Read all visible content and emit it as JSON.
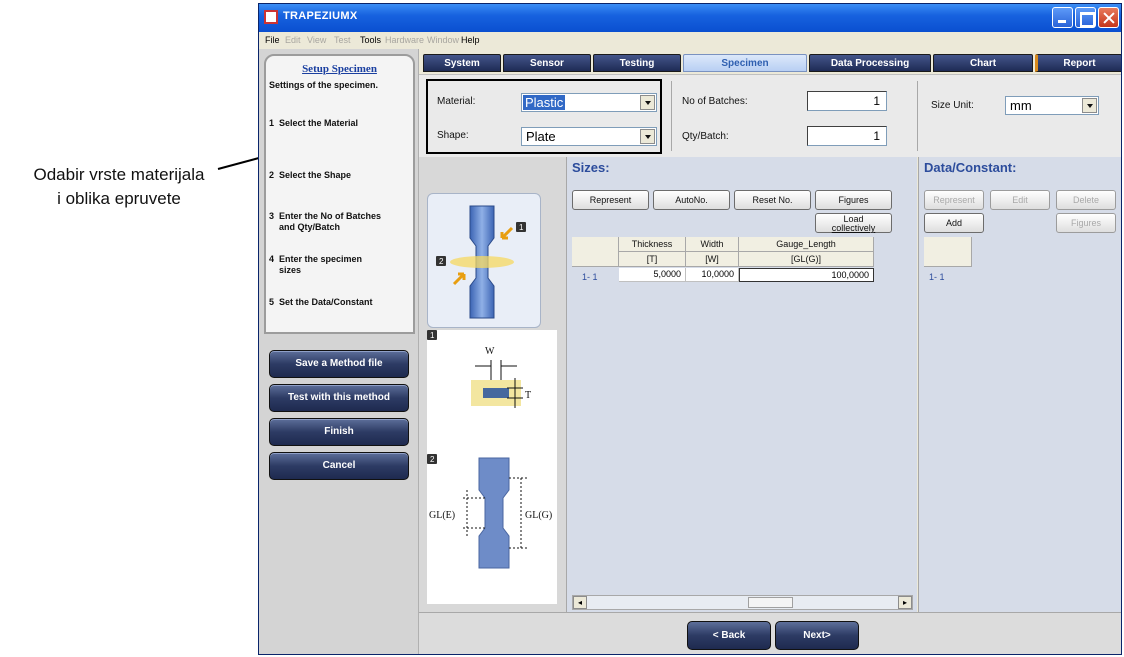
{
  "callout": {
    "line1": "Odabir vrste materijala",
    "line2": "i oblika epruvete"
  },
  "window": {
    "title": "TRAPEZIUMX"
  },
  "menu": {
    "file": "File",
    "edit": "Edit",
    "view": "View",
    "test": "Test",
    "tools": "Tools",
    "hardware": "Hardware",
    "window": "Window",
    "help": "Help"
  },
  "wizard": {
    "title": "Setup Specimen",
    "subtitle": "Settings of the specimen.",
    "steps": [
      {
        "num": "1",
        "text": "Select the Material"
      },
      {
        "num": "2",
        "text": "Select the Shape"
      },
      {
        "num": "3",
        "text": "Enter the No of Batches",
        "text2": "and Qty/Batch"
      },
      {
        "num": "4",
        "text": "Enter the specimen",
        "text2": "sizes"
      },
      {
        "num": "5",
        "text": "Set the Data/Constant"
      }
    ],
    "actions": [
      "Save a Method file",
      "Test with this method",
      "Finish",
      "Cancel"
    ]
  },
  "tabs": [
    "System",
    "Sensor",
    "Testing",
    "Specimen",
    "Data Processing",
    "Chart",
    "Report"
  ],
  "active_tab": "Specimen",
  "settings": {
    "material_label": "Material:",
    "material_value": "Plastic",
    "shape_label": "Shape:",
    "shape_value": "Plate",
    "batches_label": "No of Batches:",
    "batches_value": "1",
    "qty_label": "Qty/Batch:",
    "qty_value": "1",
    "size_unit_label": "Size Unit:",
    "size_unit_value": "mm"
  },
  "diagram": {
    "badge1": "1",
    "badge2": "2",
    "w_label": "W",
    "t_label": "T",
    "gle_label": "GL(E)",
    "glg_label": "GL(G)"
  },
  "sizes": {
    "title": "Sizes:",
    "buttons": {
      "represent": "Represent",
      "autono": "AutoNo.",
      "resetno": "Reset No.",
      "figures": "Figures",
      "load1": "Load",
      "load2": "collectively"
    },
    "columns": [
      {
        "name": "Thickness",
        "unit": "[T]"
      },
      {
        "name": "Width",
        "unit": "[W]"
      },
      {
        "name": "Gauge_Length",
        "unit": "[GL(G)]"
      }
    ],
    "rows": [
      {
        "label": "1- 1",
        "values": [
          "5,0000",
          "10,0000",
          "100,0000"
        ]
      }
    ]
  },
  "data_constant": {
    "title": "Data/Constant:",
    "buttons": {
      "represent": "Represent",
      "edit": "Edit",
      "delete": "Delete",
      "add": "Add",
      "figures": "Figures"
    },
    "rows": [
      "1- 1"
    ]
  },
  "nav": {
    "back": "< Back",
    "next": "Next>"
  },
  "colors": {
    "accent": "#2c4c9c",
    "selection": "#3169c6",
    "tab_dark": "#1e2b55",
    "title_bar": "#1762df"
  }
}
